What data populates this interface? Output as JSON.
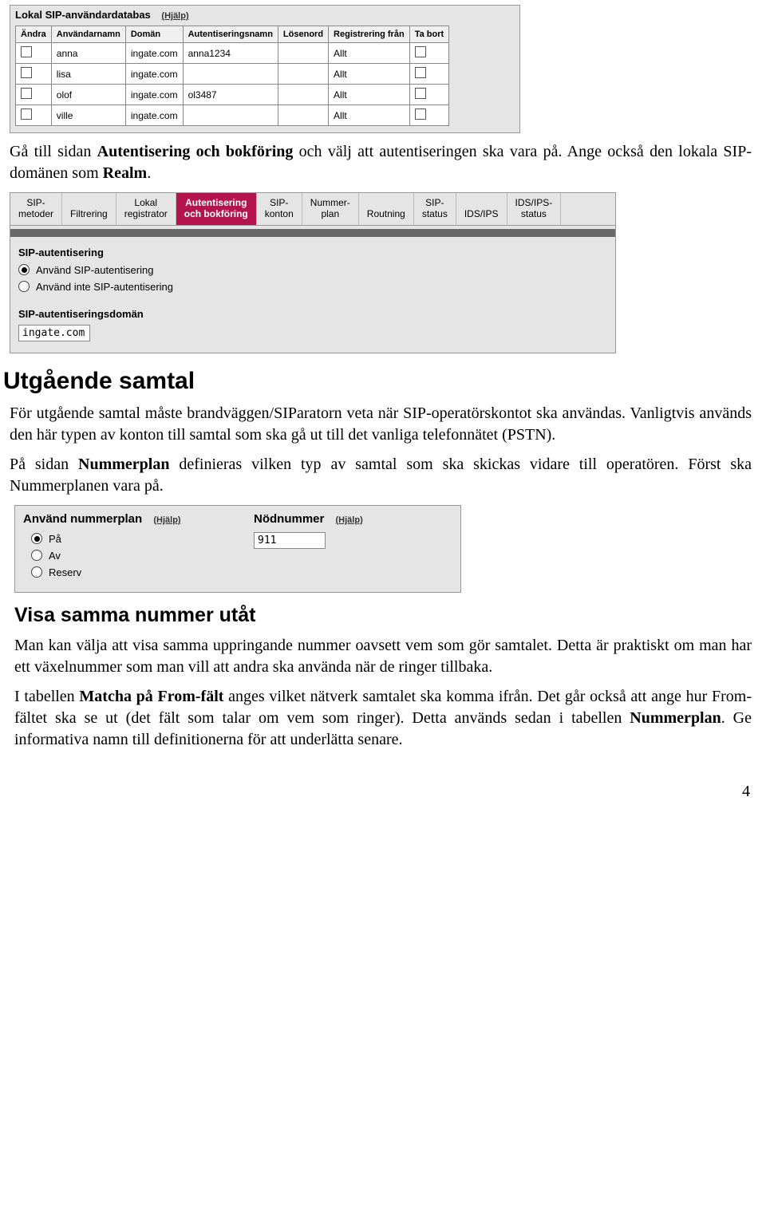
{
  "userdb": {
    "title": "Lokal SIP-användardatabas",
    "help": "(Hjälp)",
    "headers": [
      "Ändra",
      "Användarnamn",
      "Domän",
      "Autentiseringsnamn",
      "Lösenord",
      "Registrering från",
      "Ta bort"
    ],
    "rows": [
      {
        "user": "anna",
        "domain": "ingate.com",
        "auth": "anna1234",
        "reg": "Allt"
      },
      {
        "user": "lisa",
        "domain": "ingate.com",
        "auth": "",
        "reg": "Allt"
      },
      {
        "user": "olof",
        "domain": "ingate.com",
        "auth": "ol3487",
        "reg": "Allt"
      },
      {
        "user": "ville",
        "domain": "ingate.com",
        "auth": "",
        "reg": "Allt"
      }
    ]
  },
  "para1a": "Gå till sidan ",
  "para1b": "Autentisering och bokföring",
  "para1c": " och välj att autentiseringen ska vara på. Ange också den lokala SIP-domänen som ",
  "para1d": "Realm",
  "para1e": ".",
  "tabs": {
    "t1a": "SIP-",
    "t1b": "metoder",
    "t2": "Filtrering",
    "t3a": "Lokal",
    "t3b": "registrator",
    "t4a": "Autentisering",
    "t4b": "och bokföring",
    "t5a": "SIP-",
    "t5b": "konton",
    "t6a": "Nummer-",
    "t6b": "plan",
    "t7": "Routning",
    "t8a": "SIP-",
    "t8b": "status",
    "t9": "IDS/IPS",
    "t10a": "IDS/IPS-",
    "t10b": "status"
  },
  "auth": {
    "title": "SIP-autentisering",
    "opt1": "Använd SIP-autentisering",
    "opt2": "Använd inte SIP-autentisering",
    "domtitle": "SIP-autentiseringsdomän",
    "domvalue": "ingate.com"
  },
  "sec1": {
    "title": "Utgående samtal",
    "p1": "För utgående samtal måste brandväggen/SIParatorn veta när SIP-operatörskontot ska användas. Vanligtvis används den här typen av konton till samtal som ska gå ut till det vanliga telefonnätet (PSTN).",
    "p2a": "På sidan ",
    "p2b": "Nummerplan",
    "p2c": " definieras vilken typ av samtal som ska skickas vidare till operatören. Först ska Nummerplanen vara på."
  },
  "nummer": {
    "t1": "Använd nummerplan",
    "help": "(Hjälp)",
    "o1": "På",
    "o2": "Av",
    "o3": "Reserv",
    "t2": "Nödnummer",
    "val": "911"
  },
  "sec2": {
    "title": "Visa samma nummer utåt",
    "p1": "Man kan välja att visa samma uppringande nummer oavsett vem som gör samtalet. Detta är praktiskt om man har ett växelnummer som man vill att andra ska använda när de ringer tillbaka.",
    "p2a": "I tabellen ",
    "p2b": "Matcha på From-fält",
    "p2c": " anges vilket nätverk samtalet ska komma ifrån. Det går också att ange hur From-fältet ska se ut (det fält som talar om vem som ringer). Detta används sedan i tabellen ",
    "p2d": "Nummerplan",
    "p2e": ". Ge informativa namn till definitionerna för att underlätta senare."
  },
  "pagenum": "4"
}
